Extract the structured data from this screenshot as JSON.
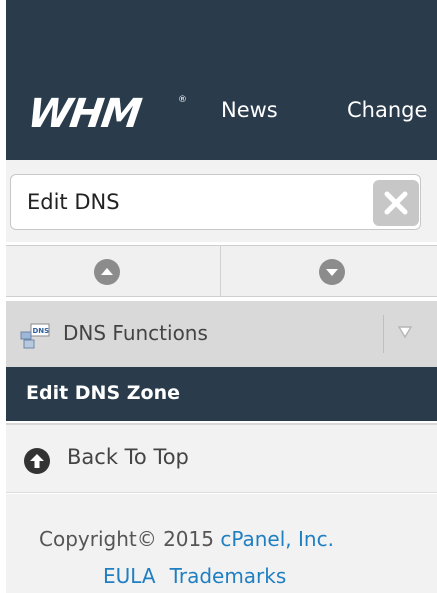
{
  "header": {
    "logo_text": "WHM",
    "logo_mark": "®",
    "nav": [
      "News",
      "Change"
    ]
  },
  "search": {
    "value": "Edit DNS",
    "clear_icon": "close-icon"
  },
  "scroll": {
    "up_icon": "arrow-up-circle-icon",
    "down_icon": "arrow-down-circle-icon"
  },
  "category": {
    "icon": "dns-icon",
    "icon_text": "DNS",
    "label": "DNS Functions",
    "toggle_icon": "chevron-down-icon"
  },
  "active_item": {
    "label": "Edit DNS Zone"
  },
  "back_to_top": {
    "icon": "arrow-up-circle-icon",
    "label": "Back To Top"
  },
  "footer": {
    "copyright": "Copyright© 2015",
    "company": "cPanel, Inc.",
    "links": [
      "EULA",
      "Trademarks"
    ]
  },
  "colors": {
    "header_bg": "#2a3b4c",
    "link": "#1f7fc3",
    "category_bg": "#d9d9d9"
  }
}
